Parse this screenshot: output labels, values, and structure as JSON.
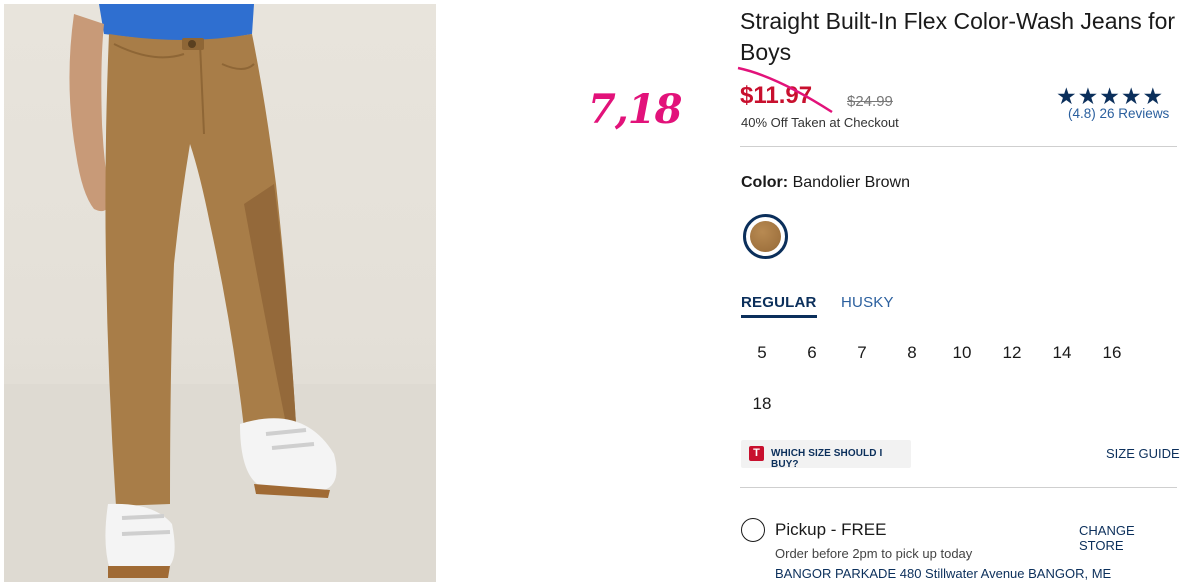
{
  "annotation": {
    "text": "7,18"
  },
  "product": {
    "title": "Straight Built-In Flex Color-Wash Jeans for Boys",
    "sale_price": "$11.97",
    "original_price": "$24.99",
    "discount_note": "40% Off Taken at Checkout",
    "rating": {
      "stars": "★★★★★",
      "value": "(4.8)",
      "reviews": "26 Reviews"
    }
  },
  "color": {
    "label": "Color:",
    "name": "Bandolier Brown"
  },
  "fit_tabs": [
    {
      "label": "REGULAR",
      "selected": true
    },
    {
      "label": "HUSKY",
      "selected": false
    }
  ],
  "sizes": [
    "5",
    "6",
    "7",
    "8",
    "10",
    "12",
    "14",
    "16",
    "18"
  ],
  "fit_help": {
    "badge": "T",
    "label": "WHICH SIZE SHOULD I BUY?"
  },
  "size_guide": "SIZE GUIDE",
  "pickup": {
    "label": "Pickup - FREE",
    "change_store": "CHANGE STORE",
    "note": "Order before 2pm to pick up today",
    "store": "BANGOR PARKADE 480 Stillwater Avenue  BANGOR, ME"
  },
  "colors": {
    "brand_navy": "#0b2f5b",
    "sale_red": "#c8102e",
    "annotation_pink": "#e2127a"
  }
}
